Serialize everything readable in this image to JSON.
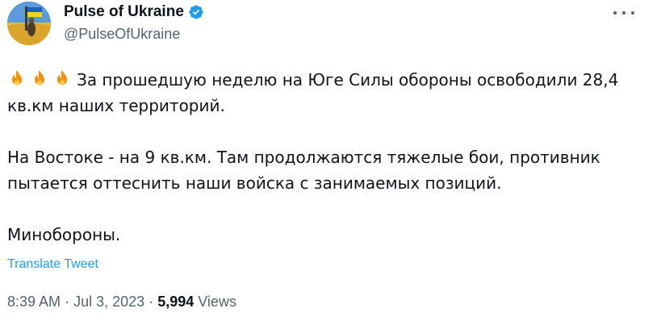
{
  "author": {
    "name": "Pulse of Ukraine",
    "handle": "@PulseOfUkraine",
    "verified_icon": "verified-badge-icon"
  },
  "more_button_icon": "more-horizontal-icon",
  "tweet": {
    "emoji_icon": "fire-icon",
    "emoji_count": 3,
    "line1": "За прошедшую неделю на Юге Силы обороны освободили 28,4 кв.км наших территорий.",
    "line2": "На Востоке - на 9 кв.км. Там продолжаются тяжелые бои, противник пытается оттеснить наши войска с занимаемых позиций.",
    "line3": "Минобороны."
  },
  "translate_label": "Translate Tweet",
  "meta": {
    "time": "8:39 AM",
    "separator": "·",
    "date": "Jul 3, 2023",
    "views_count": "5,994",
    "views_label": "Views"
  },
  "colors": {
    "text": "#0f1419",
    "secondary": "#536471",
    "link": "#1d9bf0",
    "verified": "#1d9bf0"
  }
}
